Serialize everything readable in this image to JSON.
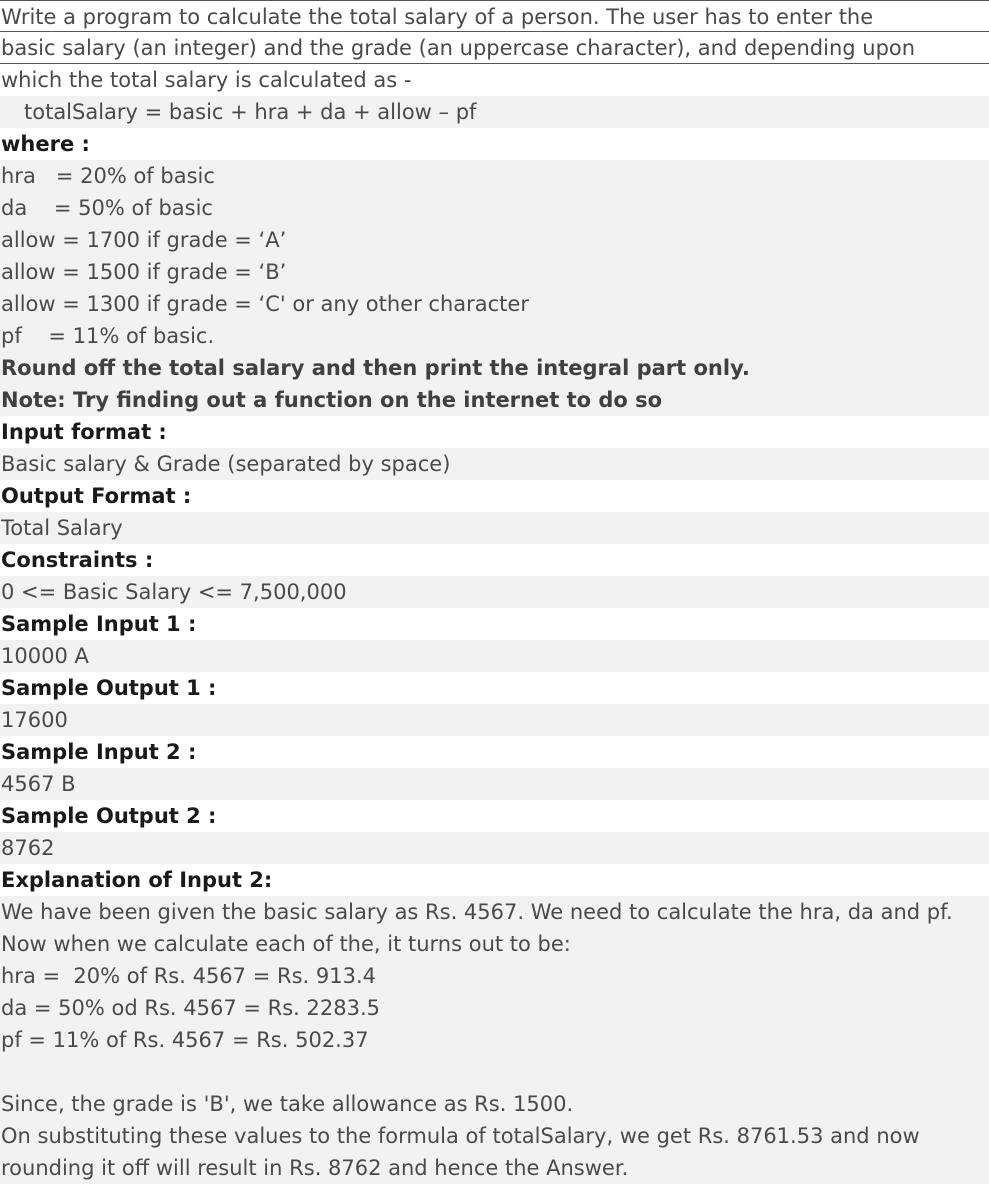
{
  "problem": {
    "intro": [
      "Write a program to calculate the total salary of a person. The user has to enter the",
      "basic salary (an integer) and the grade (an uppercase character), and depending upon",
      "which the total salary is calculated as -"
    ],
    "formula": "totalSalary = basic + hra + da + allow – pf",
    "where_heading": "where :",
    "definitions": [
      "hra   = 20% of basic",
      "da    = 50% of basic",
      "allow = 1700 if grade = ‘A’",
      "allow = 1500 if grade = ‘B’",
      "allow = 1300 if grade = ‘C' or any other character",
      "pf    = 11% of basic."
    ],
    "round_note": "Round off the total salary and then print the integral part only.",
    "internet_note": "Note: Try finding out a function on the internet to do so"
  },
  "sections": {
    "input_format_heading": "Input format :",
    "input_format_text": "Basic salary & Grade (separated by space)",
    "output_format_heading": "Output Format :",
    "output_format_text": "Total Salary",
    "constraints_heading": "Constraints :",
    "constraints_text": "0 <= Basic Salary <= 7,500,000",
    "sample_input_1_heading": "Sample Input 1 :",
    "sample_input_1_text": "10000 A",
    "sample_output_1_heading": "Sample Output 1 :",
    "sample_output_1_text": "17600",
    "sample_input_2_heading": "Sample Input 2 :",
    "sample_input_2_text": "4567 B",
    "sample_output_2_heading": "Sample Output 2 :",
    "sample_output_2_text": "8762",
    "explanation_heading": "Explanation of Input 2:"
  },
  "explanation": {
    "lines": [
      "We have been given the basic salary as Rs. 4567. We need to calculate the hra, da and pf.",
      "Now when we calculate each of the, it turns out to be:",
      "hra =  20% of Rs. 4567 = Rs. 913.4",
      "da = 50% od Rs. 4567 = Rs. 2283.5",
      "pf = 11% of Rs. 4567 = Rs. 502.37",
      "",
      "Since, the grade is 'B', we take allowance as Rs. 1500.",
      "On substituting these values to the formula of totalSalary, we get Rs. 8761.53 and now",
      "rounding it off will result in Rs. 8762 and hence the Answer."
    ]
  }
}
